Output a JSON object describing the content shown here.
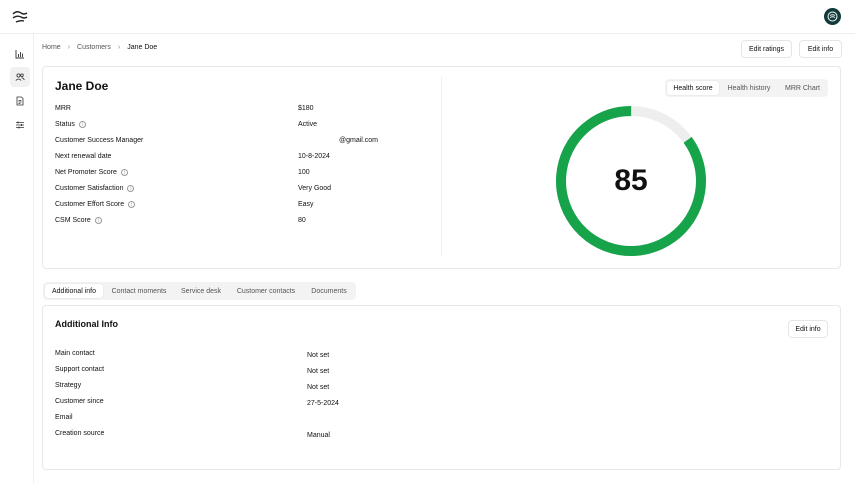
{
  "breadcrumb": {
    "home": "Home",
    "customers": "Customers",
    "current": "Jane Doe"
  },
  "header_actions": {
    "edit_ratings": "Edit ratings",
    "edit_info": "Edit info"
  },
  "customer": {
    "name": "Jane Doe",
    "rows": [
      {
        "label": "MRR",
        "value": "$180"
      },
      {
        "label": "Status",
        "value": "Active"
      },
      {
        "label": "Customer Success Manager",
        "value": "@gmail.com"
      },
      {
        "label": "Next renewal date",
        "value": "10-8-2024"
      },
      {
        "label": "Net Promoter Score",
        "value": "100"
      },
      {
        "label": "Customer Satisfaction",
        "value": "Very Good"
      },
      {
        "label": "Customer Effort Score",
        "value": "Easy"
      },
      {
        "label": "CSM Score",
        "value": "80"
      }
    ]
  },
  "score_tabs": [
    "Health score",
    "Health history",
    "MRR Chart"
  ],
  "health": {
    "score": "85",
    "fraction": 0.85,
    "color": "#16a34a",
    "track_color": "#eeeeee"
  },
  "detail_tabs": [
    "Additional info",
    "Contact moments",
    "Service desk",
    "Customer contacts",
    "Documents"
  ],
  "additional_info": {
    "title": "Additional Info",
    "edit_label": "Edit info",
    "rows": [
      {
        "label": "Main contact",
        "value": "Not set"
      },
      {
        "label": "Support contact",
        "value": "Not set"
      },
      {
        "label": "Strategy",
        "value": "Not set"
      },
      {
        "label": "Customer since",
        "value": "27-5-2024"
      },
      {
        "label": "Email",
        "value": ""
      },
      {
        "label": "Creation source",
        "value": "Manual"
      }
    ]
  }
}
